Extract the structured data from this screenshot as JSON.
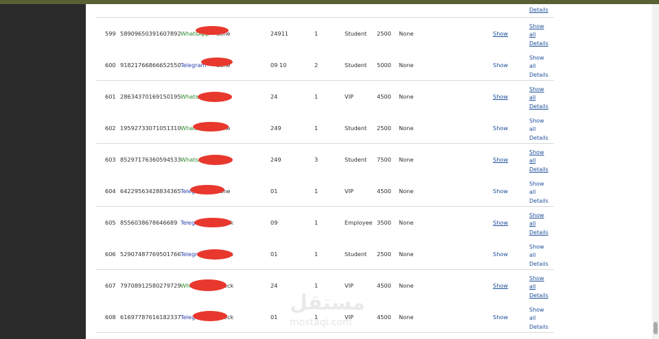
{
  "page": {
    "prev_row_details_label": "Details",
    "watermark": {
      "logo": "مستقل",
      "text": "mostaqi.com"
    }
  },
  "rows": [
    {
      "num": "599",
      "id": "58909650391607892",
      "source": "WhatsApp",
      "source_type": "whatsapp",
      "status": "done",
      "phone_visible": "24911",
      "qty": "1",
      "category": "Student",
      "price": "2500",
      "note": "None",
      "show_label": "Show",
      "details": [
        "Show",
        "all",
        "Details"
      ]
    },
    {
      "num": "600",
      "id": "91821766866652550",
      "source": "Telegram",
      "source_type": "telegram",
      "status": "done",
      "phone_visible": "09        10",
      "qty": "2",
      "category": "Student",
      "price": "5000",
      "note": "None",
      "show_label": "Show",
      "details": [
        "Show",
        "all",
        "Details"
      ]
    },
    {
      "num": "601",
      "id": "28634370169150195",
      "source": "WhatsApp",
      "source_type": "whatsapp",
      "status": "done",
      "phone_visible": "24",
      "qty": "1",
      "category": "VIP",
      "price": "4500",
      "note": "None",
      "show_label": "Show",
      "details": [
        "Show",
        "all",
        "Details"
      ]
    },
    {
      "num": "602",
      "id": "19592733071051310",
      "source": "WhatsApp",
      "source_type": "whatsapp",
      "status": "done",
      "phone_visible": "249",
      "qty": "1",
      "category": "Student",
      "price": "2500",
      "note": "None",
      "show_label": "Show",
      "details": [
        "Show",
        "all",
        "Details"
      ]
    },
    {
      "num": "603",
      "id": "85297176360594533",
      "source": "WhatsApp",
      "source_type": "whatsapp",
      "status": "done",
      "phone_visible": "249",
      "qty": "3",
      "category": "Student",
      "price": "7500",
      "note": "None",
      "show_label": "Show",
      "details": [
        "Show",
        "all",
        "Details"
      ]
    },
    {
      "num": "604",
      "id": "64229563428834365",
      "source": "Telegram",
      "source_type": "telegram",
      "status": "done",
      "phone_visible": "01",
      "qty": "1",
      "category": "VIP",
      "price": "4500",
      "note": "None",
      "show_label": "Show",
      "details": [
        "Show",
        "all",
        "Details"
      ]
    },
    {
      "num": "605",
      "id": "8556038678646689",
      "source": "Telegram",
      "source_type": "telegram",
      "status": "Check",
      "phone_visible": "09",
      "qty": "1",
      "category": "Employee",
      "price": "3500",
      "note": "None",
      "show_label": "Show",
      "details": [
        "Show",
        "all",
        "Details"
      ]
    },
    {
      "num": "606",
      "id": "52907487769501766",
      "source": "Telegram",
      "source_type": "telegram",
      "status": "Check",
      "phone_visible": "01",
      "qty": "1",
      "category": "Student",
      "price": "2500",
      "note": "None",
      "show_label": "Show",
      "details": [
        "Show",
        "all",
        "Details"
      ]
    },
    {
      "num": "607",
      "id": "79708912580279729",
      "source": "WhatsApp",
      "source_type": "whatsapp",
      "status": "Check",
      "phone_visible": "24",
      "qty": "1",
      "category": "VIP",
      "price": "4500",
      "note": "None",
      "show_label": "Show",
      "details": [
        "Show",
        "all",
        "Details"
      ]
    },
    {
      "num": "608",
      "id": "61697787616182337",
      "source": "Telegram",
      "source_type": "telegram",
      "status": "Check",
      "phone_visible": "01",
      "qty": "1",
      "category": "VIP",
      "price": "4500",
      "note": "None",
      "show_label": "Show",
      "details": [
        "Show",
        "all",
        "Details"
      ]
    }
  ],
  "colors": {
    "whatsapp": "#2a8a2a",
    "telegram": "#2b3dab",
    "link": "#1e4f9a",
    "redaction": "#e8382e",
    "topbar": "#5a5f34"
  }
}
